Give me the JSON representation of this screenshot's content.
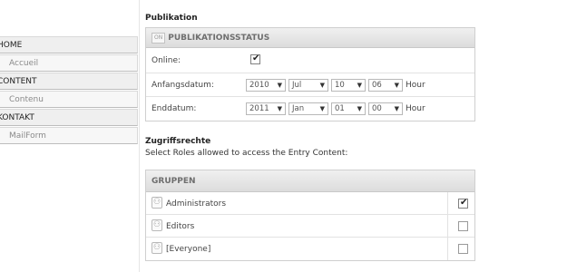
{
  "nav": {
    "items": [
      {
        "label": "HOME",
        "type": "top"
      },
      {
        "label": "Accueil",
        "type": "sub"
      },
      {
        "label": "CONTENT",
        "type": "top"
      },
      {
        "label": "Contenu",
        "type": "sub"
      },
      {
        "label": "KONTAKT",
        "type": "top"
      },
      {
        "label": "MailForm",
        "type": "sub"
      }
    ]
  },
  "publikation": {
    "section_title": "Publikation",
    "panel_chip": "ON",
    "panel_title": "PUBLIKATIONSSTATUS",
    "online_label": "Online:",
    "online_checked": true,
    "start_label": "Anfangsdatum:",
    "start": {
      "year": "2010",
      "month": "Jul",
      "day": "10",
      "hour": "06"
    },
    "end_label": "Enddatum:",
    "end": {
      "year": "2011",
      "month": "Jan",
      "day": "01",
      "hour": "00"
    },
    "hour_label": "Hour"
  },
  "zugriff": {
    "section_title": "Zugriffsrechte",
    "description": "Select Roles allowed to access the Entry Content:",
    "panel_title": "GRUPPEN",
    "groups": [
      {
        "label": "Administrators",
        "checked": true
      },
      {
        "label": "Editors",
        "checked": false
      },
      {
        "label": "[Everyone]",
        "checked": false
      }
    ]
  },
  "icons": {
    "group": "role-group-icon",
    "dropdown": "chevron-down-icon"
  }
}
